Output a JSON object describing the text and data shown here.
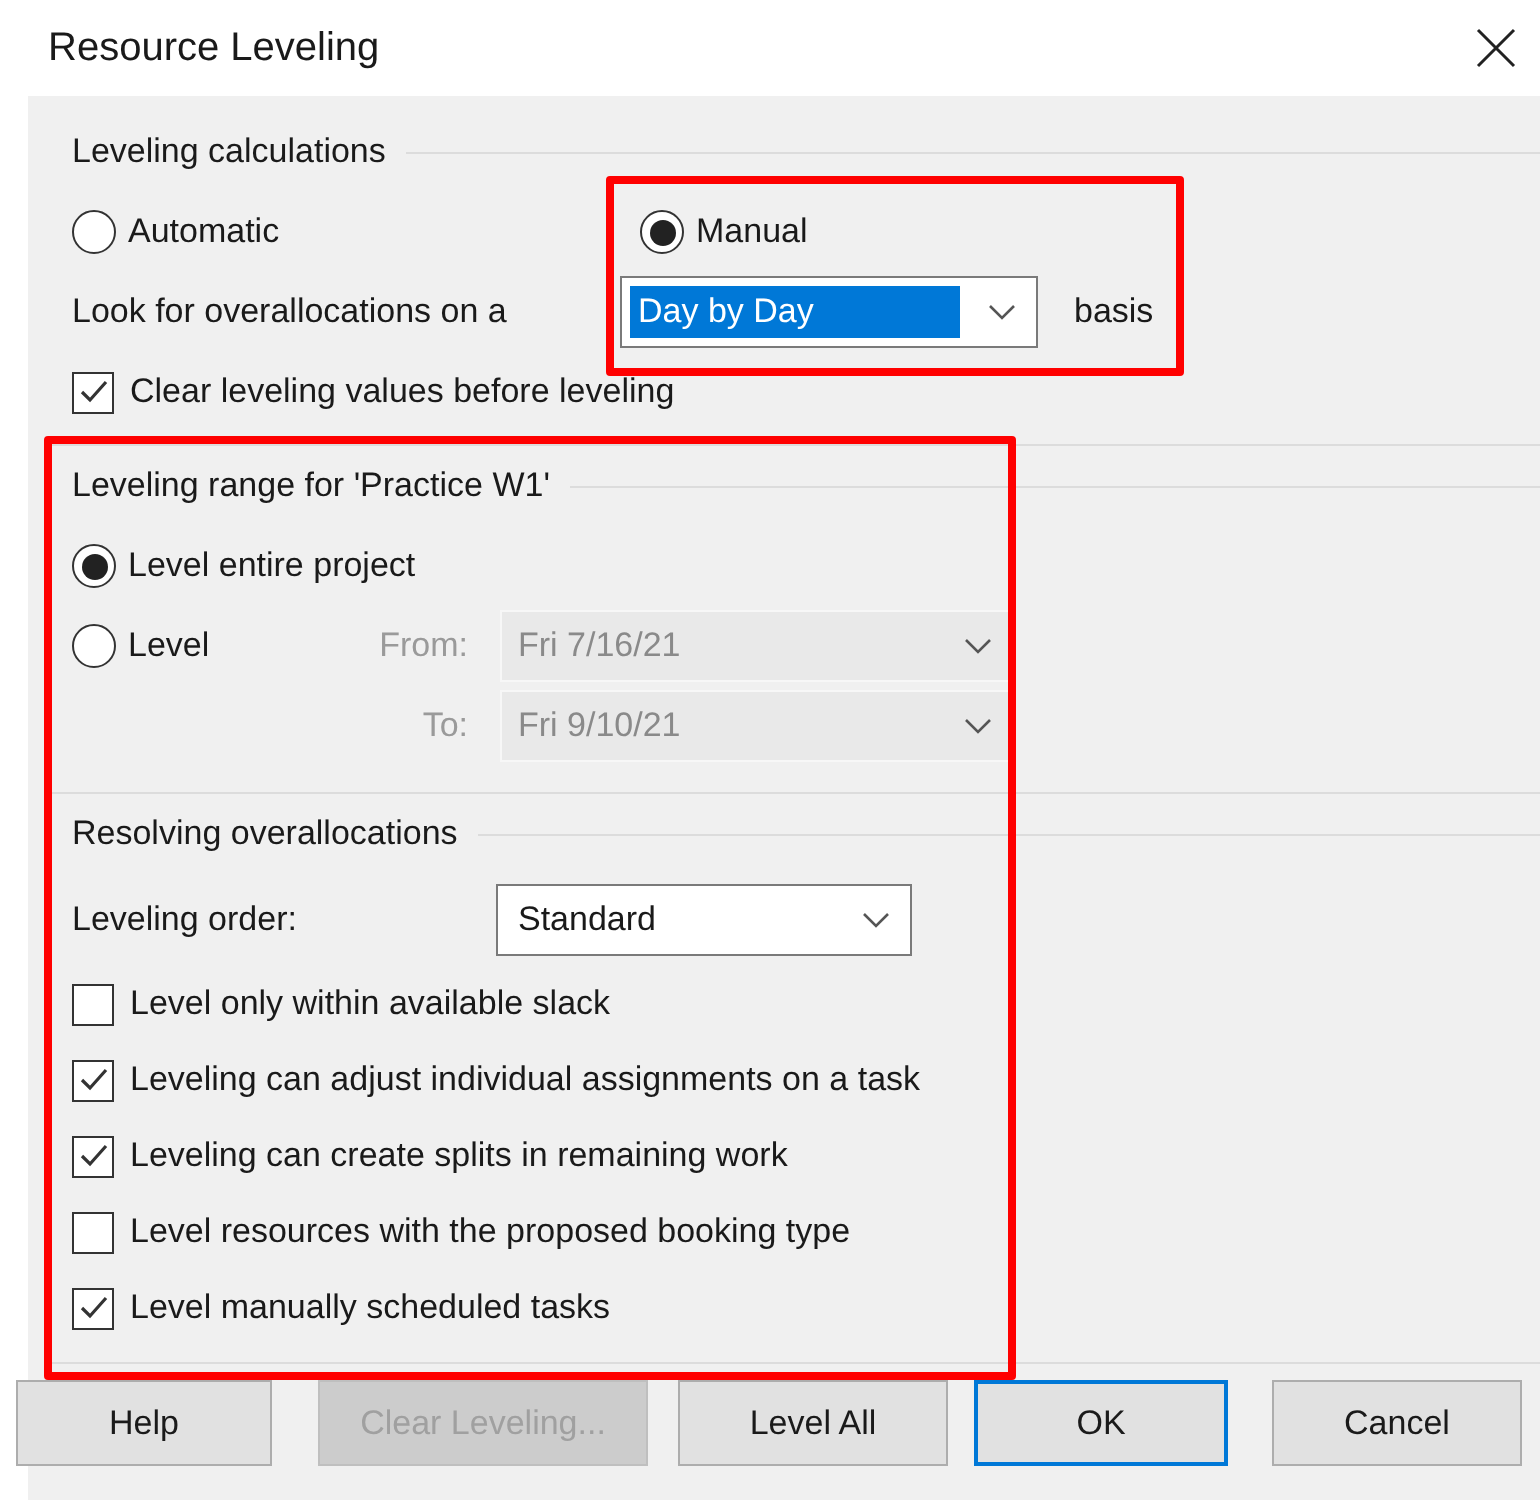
{
  "window": {
    "title": "Resource Leveling"
  },
  "calculations": {
    "title": "Leveling calculations",
    "modes": [
      {
        "label": "Automatic",
        "selected": false
      },
      {
        "label": "Manual",
        "selected": true
      }
    ],
    "look_for_label": "Look for overallocations on a",
    "basis_dropdown": {
      "value": "Day by Day",
      "highlighted": true
    },
    "basis_suffix": "basis",
    "clear_values": {
      "label": "Clear leveling values before leveling",
      "checked": true
    }
  },
  "range": {
    "title": "Leveling range for 'Practice W1'",
    "options": [
      {
        "label": "Level entire project",
        "selected": true
      },
      {
        "label": "Level",
        "selected": false
      }
    ],
    "from": {
      "label": "From:",
      "value": "Fri 7/16/21",
      "disabled": true
    },
    "to": {
      "label": "To:",
      "value": "Fri 9/10/21",
      "disabled": true
    }
  },
  "resolving": {
    "title": "Resolving overallocations",
    "order_label": "Leveling order:",
    "order_dropdown": {
      "value": "Standard"
    },
    "options": [
      {
        "label": "Level only within available slack",
        "checked": false
      },
      {
        "label": "Leveling can adjust individual assignments on a task",
        "checked": true
      },
      {
        "label": "Leveling can create splits in remaining work",
        "checked": true
      },
      {
        "label": "Level resources with the proposed booking type",
        "checked": false
      },
      {
        "label": "Level manually scheduled tasks",
        "checked": true
      }
    ]
  },
  "buttons": [
    {
      "label": "Help",
      "disabled": false,
      "default": false
    },
    {
      "label": "Clear Leveling...",
      "disabled": true,
      "default": false
    },
    {
      "label": "Level All",
      "disabled": false,
      "default": false
    },
    {
      "label": "OK",
      "disabled": false,
      "default": true
    },
    {
      "label": "Cancel",
      "disabled": false,
      "default": false
    }
  ],
  "annotations": [
    {
      "kind": "frame"
    },
    {
      "kind": "frame"
    }
  ]
}
